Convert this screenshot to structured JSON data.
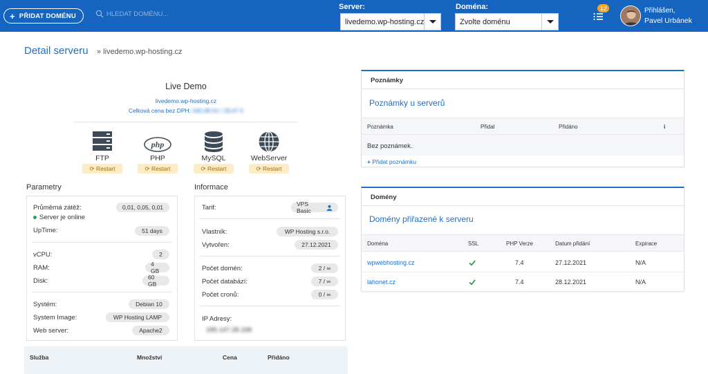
{
  "header": {
    "add_domain_label": "PŘIDAT DOMÉNU",
    "search_placeholder": "HLEDAT DOMÉNU...",
    "server_label": "Server:",
    "server_value": "livedemo.wp-hosting.cz",
    "domain_label": "Doména:",
    "domain_value": "Zvolte doménu",
    "tasks_badge": "12",
    "user_line1": "Přihlášen,",
    "user_name": "Pavel Urbánek"
  },
  "page": {
    "title": "Detail serveru",
    "crumb": "» livedemo.wp-hosting.cz"
  },
  "server": {
    "name": "Live Demo",
    "host": "livedemo.wp-hosting.cz",
    "price_label": "Celková cena bez DPH:",
    "price_value": "640,98 Kč / 26,67 €",
    "services": [
      {
        "label": "FTP",
        "icon": "server-icon"
      },
      {
        "label": "PHP",
        "icon": "php-icon"
      },
      {
        "label": "MySQL",
        "icon": "database-icon"
      },
      {
        "label": "WebServer",
        "icon": "globe-icon"
      }
    ],
    "restart_label": "Restart"
  },
  "params": {
    "title": "Parametry",
    "load_label": "Průměrná zátěž:",
    "load_value": "0,01, 0,05, 0,01",
    "online_label": "Server je online",
    "uptime_label": "UpTime:",
    "uptime_value": "51 days",
    "vcpu_label": "vCPU:",
    "vcpu_value": "2",
    "ram_label": "RAM:",
    "ram_value": "4 GB",
    "disk_label": "Disk:",
    "disk_value": "60 GB",
    "system_label": "Systém:",
    "system_value": "Debian 10",
    "image_label": "System Image:",
    "image_value": "WP Hosting LAMP",
    "web_label": "Web server:",
    "web_value": "Apache2"
  },
  "info": {
    "title": "Informace",
    "tarif_label": "Tarif:",
    "tarif_value": "VPS Basic",
    "owner_label": "Vlastník:",
    "owner_value": "WP Hosting s.r.o.",
    "created_label": "Vytvořen:",
    "created_value": "27.12.2021",
    "domains_label": "Počet domén:",
    "domains_value": "2 / ∞",
    "db_label": "Počet databází:",
    "db_value": "7 / ∞",
    "cron_label": "Počet cronů:",
    "cron_value": "0 / ∞",
    "ip_label": "IP Adresy:",
    "ip_value": "185.147.28.168"
  },
  "svc_table": {
    "cols": [
      "Služba",
      "Množství",
      "Cena",
      "Přidáno"
    ]
  },
  "notes": {
    "head": "Poznámky",
    "subtitle": "Poznámky u serverů",
    "cols": [
      "Poznámka",
      "Přidal",
      "Přidáno",
      "i"
    ],
    "empty": "Bez poznámek.",
    "add_link": "Přidat poznámku"
  },
  "domains": {
    "head": "Domény",
    "subtitle": "Domény přiřazené k serveru",
    "cols": [
      "Doména",
      "SSL",
      "PHP Verze",
      "Datum přidání",
      "Expirace"
    ],
    "rows": [
      {
        "name": "wpwebhosting.cz",
        "php": "7.4",
        "date": "27.12.2021",
        "exp": "N/A"
      },
      {
        "name": "lahonet.cz",
        "php": "7.4",
        "date": "28.12.2021",
        "exp": "N/A"
      }
    ]
  },
  "colors": {
    "brand": "#1565c0",
    "accent": "#1e6fc7",
    "restart_bg": "#fcebc4",
    "online": "#2e9e5a"
  }
}
